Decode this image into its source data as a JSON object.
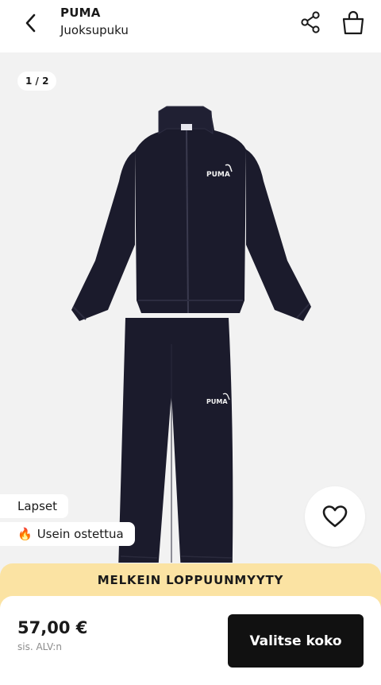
{
  "header": {
    "brand": "PUMA",
    "product_type": "Juoksupuku",
    "back_icon": "chevron-left-icon",
    "share_icon": "share-icon",
    "bag_icon": "shopping-bag-icon"
  },
  "gallery": {
    "counter": "1 / 2",
    "image_alt": "PUMA Juoksupuku",
    "tags": [
      {
        "label": "Lapset"
      },
      {
        "emoji": "🔥",
        "label": "Usein ostettua"
      }
    ],
    "favorite_icon": "heart-icon",
    "product_color": "#1b1b2c"
  },
  "banner": {
    "text": "MELKEIN LOPPUUNMYYTY",
    "color": "#fbe3a3"
  },
  "purchase": {
    "price": "57,00 €",
    "vat_note": "sis. ALV:n",
    "select_size_label": "Valitse koko"
  }
}
